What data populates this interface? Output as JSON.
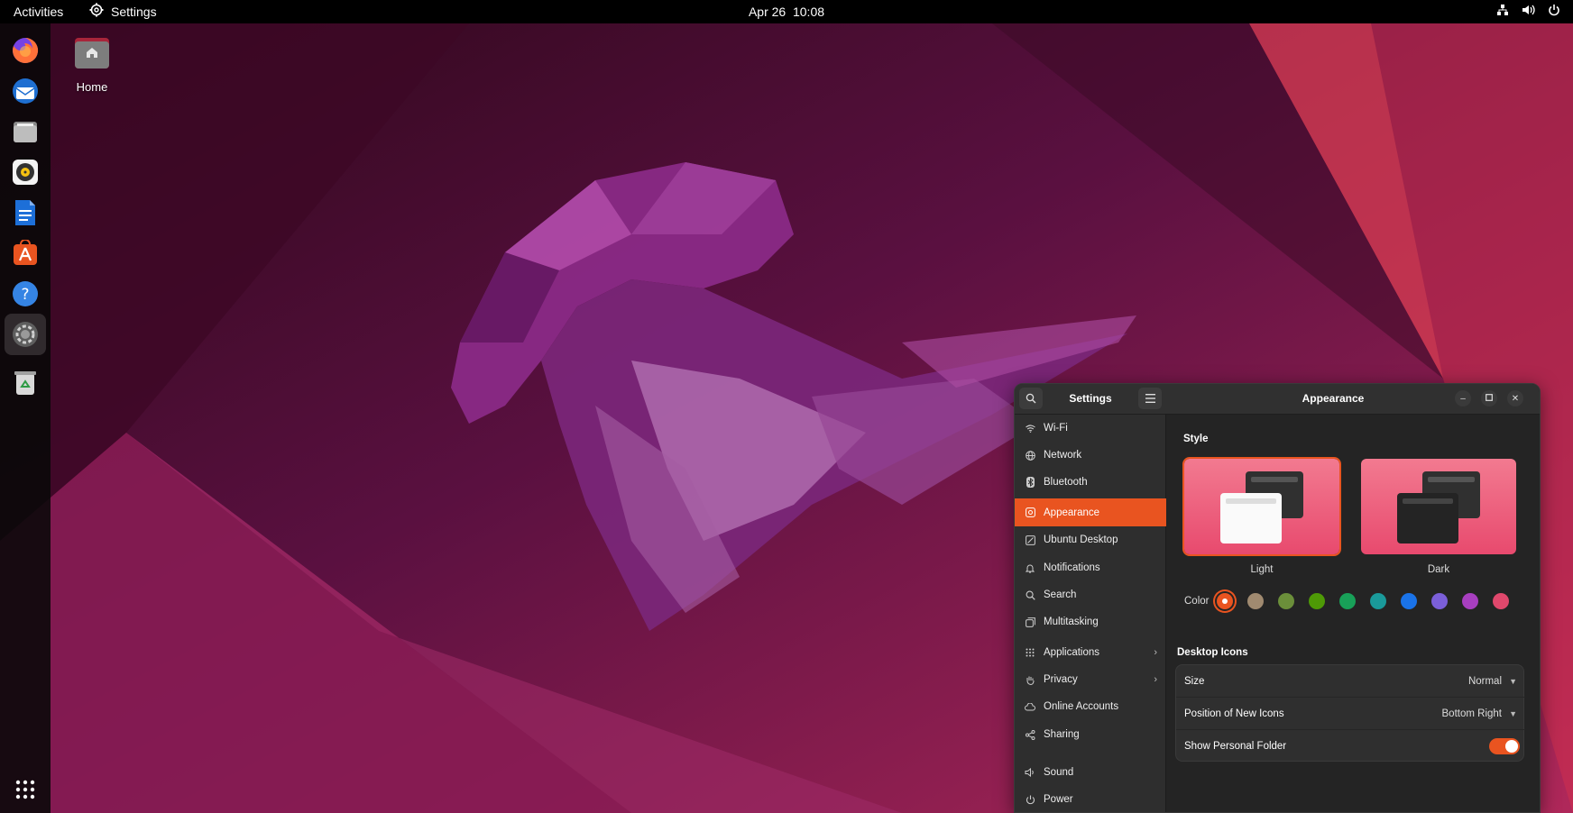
{
  "topbar": {
    "activities": "Activities",
    "app_name": "Settings",
    "date": "Apr 26",
    "time": "10:08",
    "tray_icons": [
      "network-icon",
      "volume-icon",
      "power-icon"
    ]
  },
  "dock": {
    "apps": [
      "firefox-icon",
      "thunderbird-icon",
      "files-icon",
      "rhythmbox-icon",
      "writer-icon",
      "app-center-icon",
      "help-icon",
      "settings-icon",
      "trash-icon"
    ],
    "active_app": "settings-icon",
    "show_apps_icon": "app-grid-icon"
  },
  "desktop": {
    "home_label": "Home"
  },
  "settings_window": {
    "sidebar_title": "Settings",
    "content_title": "Appearance",
    "nav": [
      {
        "label": "Wi-Fi",
        "icon": "wifi-icon"
      },
      {
        "label": "Network",
        "icon": "network-globe-icon"
      },
      {
        "label": "Bluetooth",
        "icon": "bluetooth-icon"
      },
      {
        "label": "Appearance",
        "icon": "appearance-icon",
        "selected": true
      },
      {
        "label": "Ubuntu Desktop",
        "icon": "ubuntu-desktop-icon"
      },
      {
        "label": "Notifications",
        "icon": "bell-icon"
      },
      {
        "label": "Search",
        "icon": "search-icon"
      },
      {
        "label": "Multitasking",
        "icon": "multitasking-icon"
      },
      {
        "label": "Applications",
        "icon": "apps-grid-icon",
        "chevron": true
      },
      {
        "label": "Privacy",
        "icon": "hand-icon",
        "chevron": true
      },
      {
        "label": "Online Accounts",
        "icon": "cloud-icon"
      },
      {
        "label": "Sharing",
        "icon": "share-icon"
      },
      {
        "label": "Sound",
        "icon": "speaker-icon"
      },
      {
        "label": "Power",
        "icon": "power-icon"
      }
    ],
    "style_section": "Style",
    "style_options": [
      {
        "label": "Light",
        "selected": true
      },
      {
        "label": "Dark",
        "selected": false
      }
    ],
    "color_label": "Color",
    "accent_colors": [
      "#e95420",
      "#a08a70",
      "#6b8f3a",
      "#4e9a06",
      "#18a058",
      "#1a9a9a",
      "#1a73e8",
      "#7b5fd9",
      "#a83fc0",
      "#e0486c"
    ],
    "selected_accent": "#e95420",
    "desktop_icons_section": "Desktop Icons",
    "size_label": "Size",
    "size_value": "Normal",
    "position_label": "Position of New Icons",
    "position_value": "Bottom Right",
    "show_folder_label": "Show Personal Folder",
    "show_folder_enabled": true
  }
}
